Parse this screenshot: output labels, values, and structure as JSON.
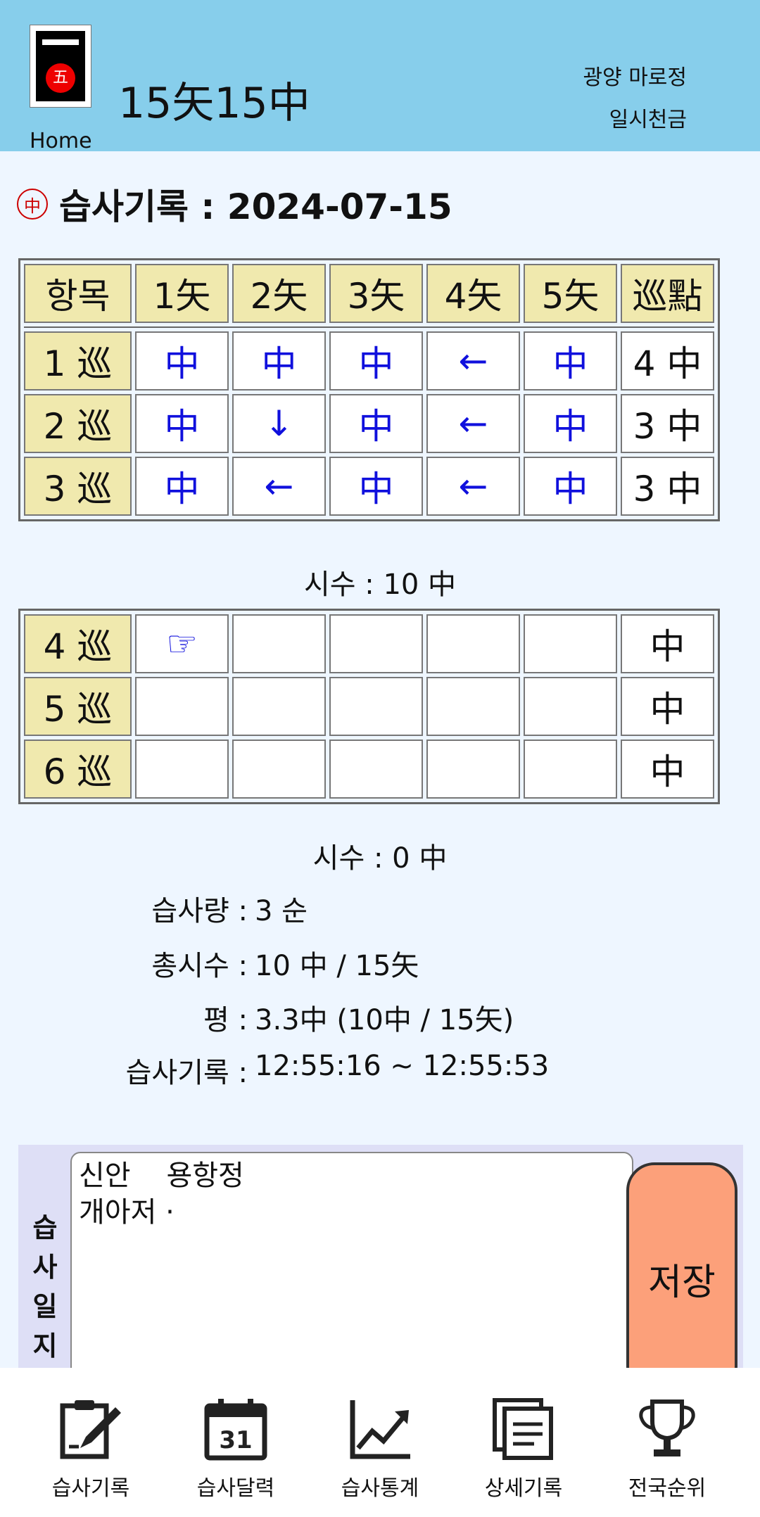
{
  "header": {
    "logo_char": "五",
    "title": "15矢15中",
    "home": "Home",
    "place": "광양 마로정",
    "sub": "일시천금"
  },
  "record": {
    "seal": "中",
    "title": "습사기록 : 2024-07-15"
  },
  "table_header": [
    "항목",
    "1矢",
    "2矢",
    "3矢",
    "4矢",
    "5矢",
    "巡點"
  ],
  "round_set_1": [
    {
      "label": "1 巡",
      "shots": [
        "中",
        "中",
        "中",
        "←",
        "中"
      ],
      "score": "4 中"
    },
    {
      "label": "2 巡",
      "shots": [
        "中",
        "↓",
        "中",
        "←",
        "中"
      ],
      "score": "3 中"
    },
    {
      "label": "3 巡",
      "shots": [
        "中",
        "←",
        "中",
        "←",
        "中"
      ],
      "score": "3 中"
    }
  ],
  "set1_total": "시수 : 10 中",
  "round_set_2": [
    {
      "label": "4 巡",
      "shots": [
        "☞",
        "",
        "",
        "",
        ""
      ],
      "score": "中"
    },
    {
      "label": "5 巡",
      "shots": [
        "",
        "",
        "",
        "",
        ""
      ],
      "score": "中"
    },
    {
      "label": "6 巡",
      "shots": [
        "",
        "",
        "",
        "",
        ""
      ],
      "score": "中"
    }
  ],
  "set2_total": "시수 : 0 中",
  "stats": [
    {
      "label": "습사량 :",
      "value": "3 순"
    },
    {
      "label": "총시수 :",
      "value": "10 中 / 15矢"
    },
    {
      "label": "평 :",
      "value": "3.3中 (10中 / 15矢)"
    },
    {
      "label": "습사기록 :",
      "value": "12:55:16 ~ 12:55:53"
    }
  ],
  "diary": {
    "label": "습\n사\n일\n지",
    "text": "신안    용항정\n개아저 ·",
    "save": "저장"
  },
  "nav": [
    {
      "label": "습사기록",
      "icon": "clipboard-pen-icon"
    },
    {
      "label": "습사달력",
      "icon": "calendar-icon",
      "day": "31"
    },
    {
      "label": "습사통계",
      "icon": "line-chart-icon"
    },
    {
      "label": "상세기록",
      "icon": "documents-icon"
    },
    {
      "label": "전국순위",
      "icon": "trophy-icon"
    }
  ],
  "colors": {
    "header_bg": "#87ceeb",
    "page_bg": "#eef6ff",
    "cell_header_bg": "#f0e9ae",
    "mark_color": "#1010dd",
    "save_bg": "#fca07a",
    "diary_bg": "#dedff6"
  }
}
